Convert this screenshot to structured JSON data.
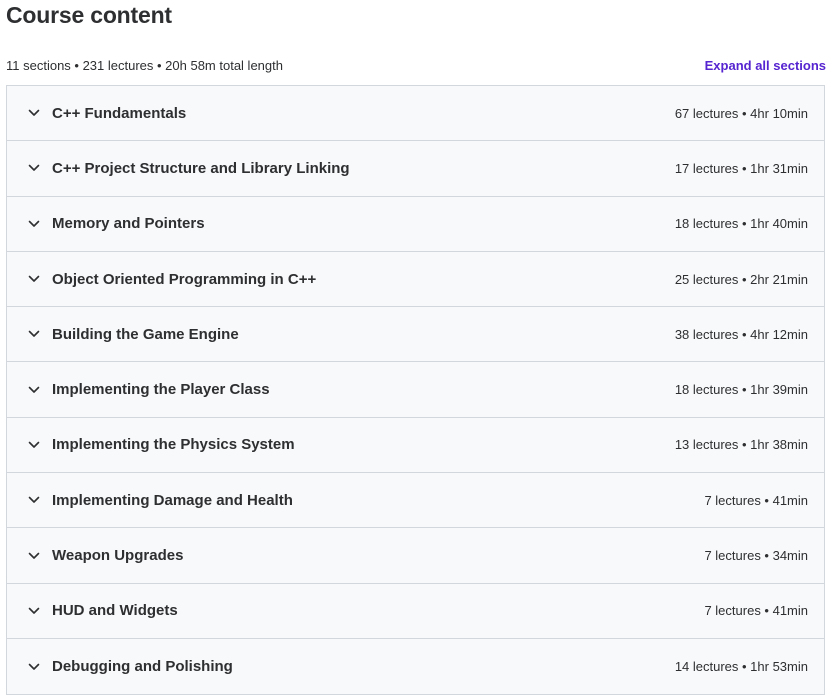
{
  "header": {
    "title": "Course content",
    "summary": "11 sections • 231 lectures • 20h 58m total length",
    "expand_all_label": "Expand all sections"
  },
  "colors": {
    "accent": "#5624d0",
    "section_bg": "#f7f9fa",
    "border": "#d1d7dc",
    "text": "#2d2f31"
  },
  "sections": [
    {
      "title": "C++ Fundamentals",
      "meta": "67 lectures • 4hr 10min",
      "icon": "chevron-down-icon"
    },
    {
      "title": "C++ Project Structure and Library Linking",
      "meta": "17 lectures • 1hr 31min",
      "icon": "chevron-down-icon"
    },
    {
      "title": "Memory and Pointers",
      "meta": "18 lectures • 1hr 40min",
      "icon": "chevron-down-icon"
    },
    {
      "title": "Object Oriented Programming in C++",
      "meta": "25 lectures • 2hr 21min",
      "icon": "chevron-down-icon"
    },
    {
      "title": "Building the Game Engine",
      "meta": "38 lectures • 4hr 12min",
      "icon": "chevron-down-icon"
    },
    {
      "title": "Implementing the Player Class",
      "meta": "18 lectures • 1hr 39min",
      "icon": "chevron-down-icon"
    },
    {
      "title": "Implementing the Physics System",
      "meta": "13 lectures • 1hr 38min",
      "icon": "chevron-down-icon"
    },
    {
      "title": "Implementing Damage and Health",
      "meta": "7 lectures • 41min",
      "icon": "chevron-down-icon"
    },
    {
      "title": "Weapon Upgrades",
      "meta": "7 lectures • 34min",
      "icon": "chevron-down-icon"
    },
    {
      "title": "HUD and Widgets",
      "meta": "7 lectures • 41min",
      "icon": "chevron-down-icon"
    },
    {
      "title": "Debugging and Polishing",
      "meta": "14 lectures • 1hr 53min",
      "icon": "chevron-down-icon"
    }
  ]
}
